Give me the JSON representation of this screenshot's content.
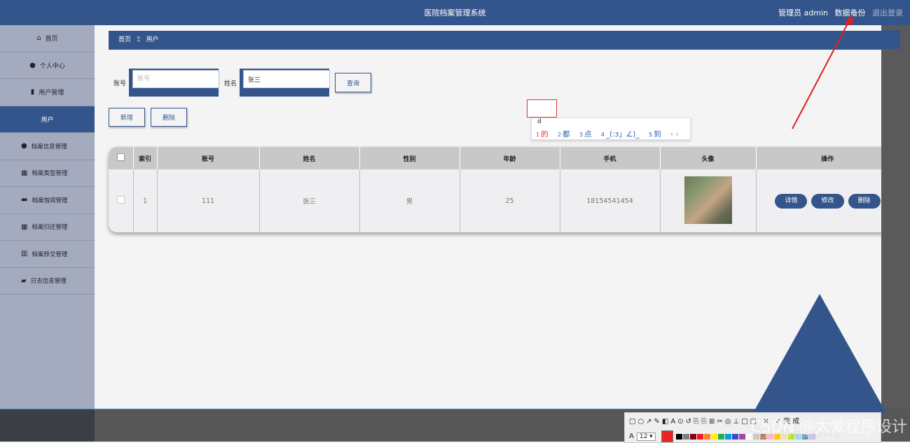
{
  "header": {
    "title": "医院档案管理系统",
    "user_label": "管理员 admin",
    "backup": "数据备份",
    "logout": "退出登录"
  },
  "sidebar": {
    "items": [
      {
        "icon": "home-icon",
        "glyph": "⌂",
        "label": "首页"
      },
      {
        "icon": "user-icon",
        "glyph": "●",
        "label": "个人中心"
      },
      {
        "icon": "book-icon",
        "glyph": "▮",
        "label": "用户管理"
      },
      {
        "label": "用户",
        "active": true
      },
      {
        "icon": "person-icon",
        "glyph": "●",
        "label": "档案信息管理"
      },
      {
        "icon": "grid-icon",
        "glyph": "▦",
        "label": "档案类型管理"
      },
      {
        "icon": "briefcase-icon",
        "glyph": "▬",
        "label": "档案借阅管理"
      },
      {
        "icon": "grid-icon",
        "glyph": "▦",
        "label": "档案归还管理"
      },
      {
        "icon": "bar-chart-icon",
        "glyph": "▥",
        "label": "档案移交管理"
      },
      {
        "icon": "comment-icon",
        "glyph": "▰",
        "label": "日志信息管理"
      }
    ]
  },
  "breadcrumb": {
    "home": "首页",
    "sep": "Ξ",
    "current": "用户"
  },
  "search": {
    "account_label": "账号",
    "account_placeholder": "账号",
    "account_value": "",
    "name_label": "姓名",
    "name_value": "张三",
    "query_button": "查询"
  },
  "actions": {
    "add": "新增",
    "delete": "删除"
  },
  "ime": {
    "typed": "d",
    "candidates": [
      {
        "n": "1",
        "t": "的"
      },
      {
        "n": "2",
        "t": "都"
      },
      {
        "n": "3",
        "t": "点"
      },
      {
        "n": "4",
        "t": "_(:з」∠)_"
      },
      {
        "n": "5",
        "t": "到"
      }
    ],
    "nav": "‹ ›"
  },
  "table": {
    "headers": [
      "",
      "索引",
      "账号",
      "姓名",
      "性别",
      "年龄",
      "手机",
      "头像",
      "操作"
    ],
    "rows": [
      {
        "index": "1",
        "account": "111",
        "name": "张三",
        "gender": "男",
        "age": "25",
        "phone": "18154541454"
      }
    ],
    "row_buttons": [
      "详情",
      "修改",
      "删除"
    ]
  },
  "toolbar": {
    "tools": "□○↗✎◧A⊙↺⎘⎘⊞✂◎⊥□▢ ✕ ✓完成",
    "font_size": "12 ▾",
    "font_icon": "A",
    "colors": [
      "#000000",
      "#7f7f7f",
      "#880015",
      "#ed1c24",
      "#ff7f27",
      "#fff200",
      "#22b14c",
      "#00a2e8",
      "#3f48cc",
      "#a349a4",
      "#ffffff",
      "#c3c3c3",
      "#b97a57",
      "#ffaec9",
      "#ffc90e",
      "#efe4b0",
      "#b5e61d",
      "#99d9ea",
      "#7092be",
      "#c8bfe7"
    ],
    "current_color": "#ee2222"
  },
  "overlay": {
    "watermark": "CSDN @太爱程序设计",
    "windows": "激活 Windows"
  }
}
